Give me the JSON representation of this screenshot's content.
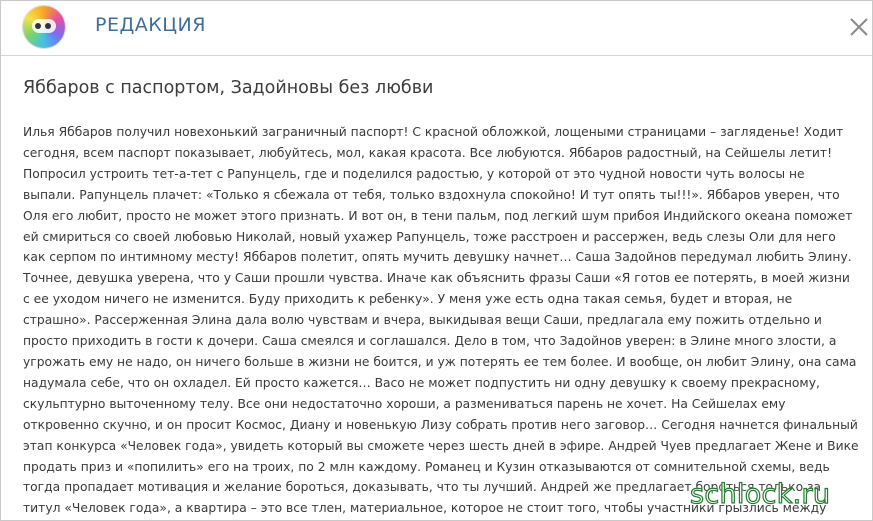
{
  "header": {
    "title": "РЕДАКЦИЯ",
    "logo_icon": "site-logo-icon",
    "close_icon": "close-icon"
  },
  "article": {
    "title": "Яббаров с паспортом, Задойновы без любви",
    "body": "Илья Яббаров получил новехонький заграничный паспорт! С красной обложкой, лощеными страницами – загляденье! Ходит сегодня, всем паспорт показывает, любуйтесь, мол, какая красота. Все любуются. Яббаров радостный, на Сейшелы летит! Попросил устроить тет-а-тет с Рапунцель, где и поделился радостью, у которой от это чудной новости чуть волосы не выпали. Рапунцель плачет: «Только я сбежала от тебя, только вздохнула спокойно! И тут опять ты!!!». Яббаров уверен, что Оля его любит, просто не может этого признать. И вот он, в тени пальм, под легкий шум прибоя Индийского океана поможет ей смириться со своей любовью￼ Николай, новый ухажер Рапунцель, тоже расстроен и рассержен, ведь слезы Оли для него как серпом по интимному месту! Яббаров полетит, опять мучить девушку начнет… Саша Задойнов передумал любить Элину. Точнее, девушка уверена, что у Саши прошли чувства. Иначе как объяснить фразы Саши «Я готов ее потерять, в моей жизни с ее уходом ничего не изменится. Буду приходить к ребенку». У меня уже есть одна такая семья, будет и вторая, не страшно». Рассерженная Элина дала волю чувствам и вчера, выкидывая вещи Саши, предлагала ему пожить отдельно и просто приходить в гости к дочери. Саша смеялся и соглашался. Дело в том, что Задойнов уверен: в Элине много злости, а угрожать ему не надо, он ничего больше в жизни не боится, и уж потерять ее тем более. И вообще, он любит Элину, она сама надумала себе, что он охладел. Ей просто кажется… Васо не может подпустить ни одну девушку к своему прекрасному, скульптурно выточенному телу. Все они недостаточно хороши, а размениваться парень не хочет. На Сейшелах ему откровенно скучно, и он просит Космос, Диану и новенькую Лизу собрать против него заговор… Сегодня начнется финальный этап конкурса «Человек года», увидеть который вы сможете через шесть дней в эфире. Андрей Чуев предлагает Жене и Вике продать приз и «попилить» его на троих, по 2 млн каждому. Романец и Кузин отказываются от сомнительной схемы, ведь тогда пропадает мотивация и желание бороться, доказывать, что ты лучший. Андрей же предлагает бороться только за титул «Человек года», а квартира – это все тлен, материальное, которое не стоит того, чтобы участники грызлись между собой и ссорились."
  },
  "watermark": {
    "text": "schlock.ru"
  },
  "colors": {
    "title": "#3f6e9a",
    "text": "#3a3a3a",
    "watermark_outline": "#1f7d2c",
    "border": "#c9c9c9"
  }
}
